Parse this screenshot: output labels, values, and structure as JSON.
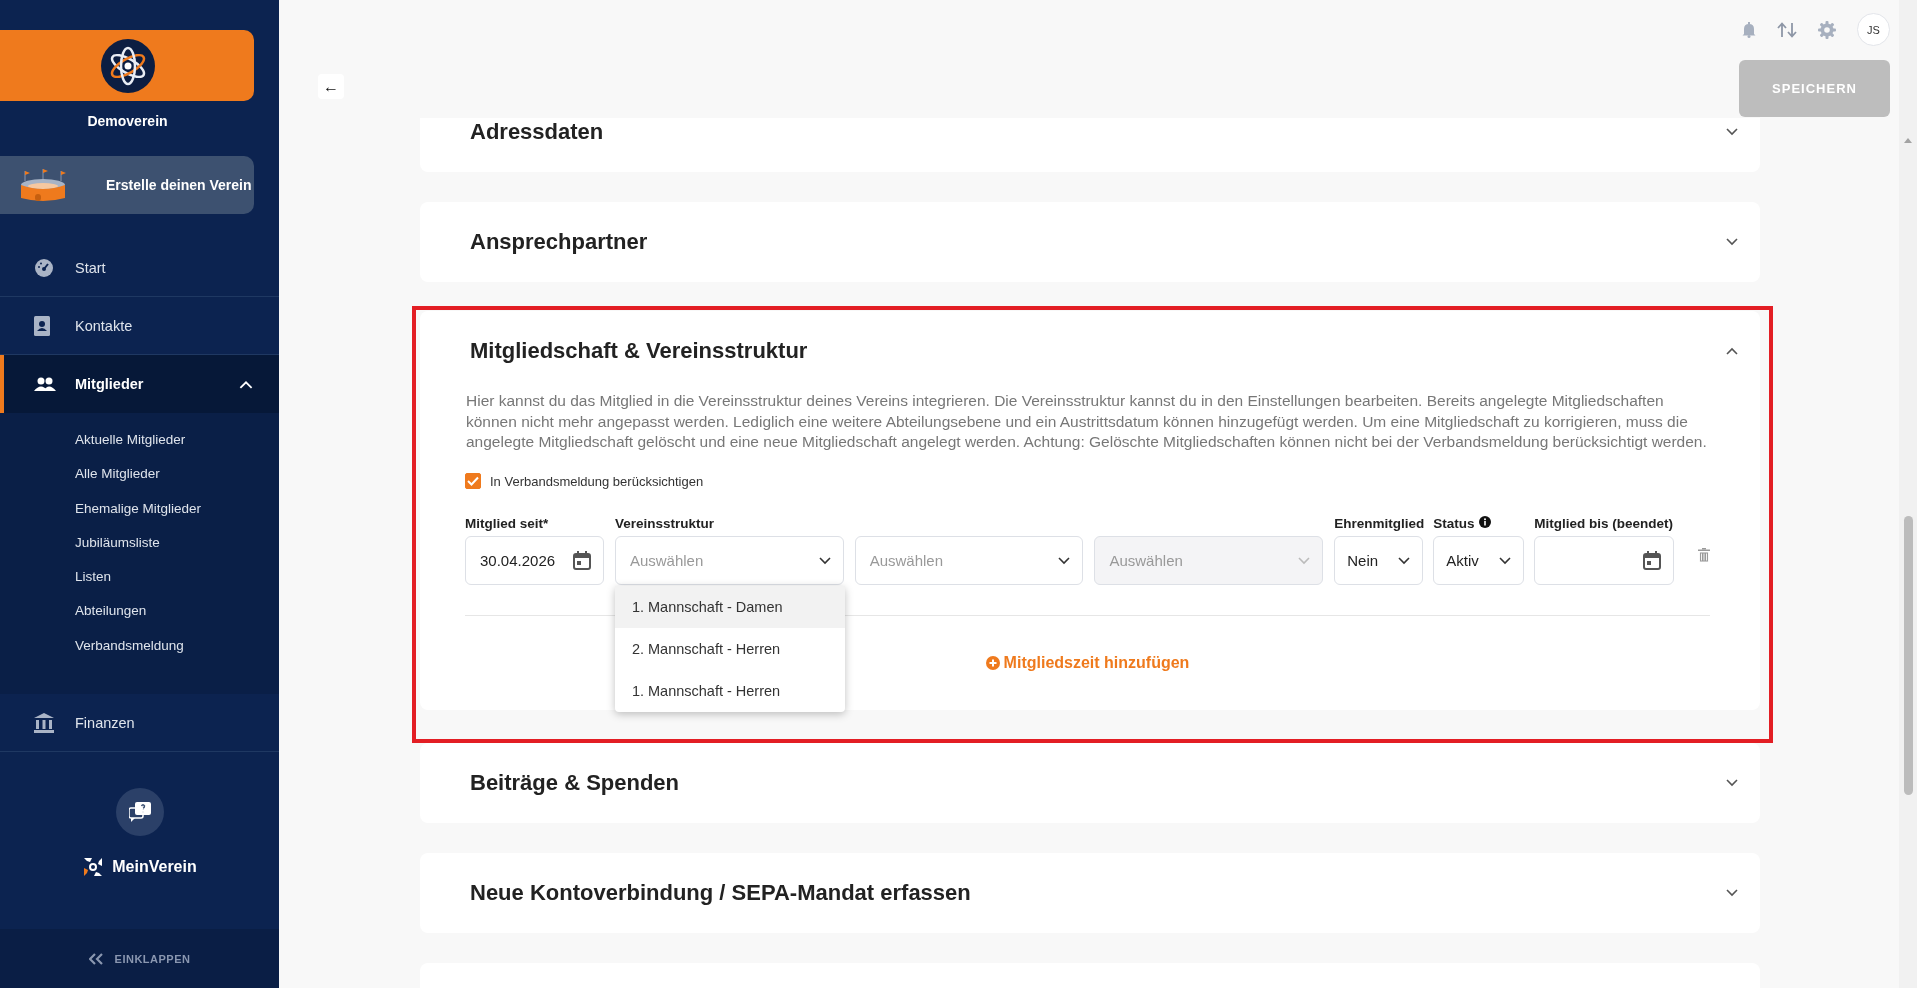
{
  "sidebar": {
    "club_name": "Demoverein",
    "create_club": "Erstelle deinen Verein",
    "nav": [
      {
        "label": "Start",
        "selected": false
      },
      {
        "label": "Kontakte",
        "selected": false
      },
      {
        "label": "Mitglieder",
        "selected": true,
        "expanded": true,
        "children": [
          {
            "label": "Aktuelle Mitglieder",
            "selected": false
          },
          {
            "label": "Alle Mitglieder",
            "selected": false
          },
          {
            "label": "Ehemalige Mitglieder",
            "selected": false
          },
          {
            "label": "Jubiläumsliste",
            "selected": false
          },
          {
            "label": "Listen",
            "selected": false
          },
          {
            "label": "Abteilungen",
            "selected": false
          },
          {
            "label": "Verbandsmeldung",
            "selected": false
          }
        ]
      },
      {
        "label": "Finanzen",
        "selected": false
      }
    ],
    "brand": "MeinVerein",
    "collapse": "EINKLAPPEN"
  },
  "topbar": {
    "back": "←",
    "avatar": "JS",
    "save": {
      "label": "SPEICHERN",
      "disabled": true
    }
  },
  "sections": [
    {
      "title": "Adressdaten",
      "expanded": false,
      "highlighted": false
    },
    {
      "title": "Ansprechpartner",
      "expanded": false,
      "highlighted": false
    },
    {
      "title": "Mitgliedschaft & Vereinsstruktur",
      "expanded": true,
      "highlighted": true,
      "description": "Hier kannst du das Mitglied in die Vereinsstruktur deines Vereins integrieren. Die Vereinsstruktur kannst du in den Einstellungen bearbeiten. Bereits angelegte Mitgliedschaften können nicht mehr angepasst werden. Lediglich eine weitere Abteilungsebene und ein Austrittsdatum können hinzugefügt werden. Um eine Mitgliedschaft zu korrigieren, muss die angelegte Mitgliedschaft gelöscht und eine neue Mitgliedschaft angelegt werden. Achtung: Gelöschte Mitgliedschaften können nicht bei der Verbandsmeldung berücksichtigt werden.",
      "checkbox": {
        "label": "In Verbandsmeldung berücksichtigen",
        "checked": true
      },
      "fields": [
        {
          "kind": "date",
          "label": "Mitglied seit*",
          "value": "30.04.2026"
        },
        {
          "kind": "select",
          "label": "Vereinsstruktur",
          "placeholder": "Auswählen",
          "disabled": false,
          "open": true,
          "options": [
            {
              "label": "1. Mannschaft - Damen",
              "highlighted": true
            },
            {
              "label": "2. Mannschaft - Herren",
              "highlighted": false
            },
            {
              "label": "1. Mannschaft - Herren",
              "highlighted": false
            }
          ]
        },
        {
          "kind": "select",
          "placeholder": "Auswählen",
          "disabled": false
        },
        {
          "kind": "select",
          "placeholder": "Auswählen",
          "disabled": true
        },
        {
          "kind": "select",
          "label": "Ehrenmitglied",
          "value": "Nein",
          "disabled": false
        },
        {
          "kind": "select",
          "label": "Status",
          "info": true,
          "value": "Aktiv",
          "disabled": false
        },
        {
          "kind": "date",
          "label": "Mitglied bis (beendet)"
        }
      ],
      "add_link": "Mitgliedszeit hinzufügen"
    },
    {
      "title": "Beiträge & Spenden",
      "expanded": false,
      "highlighted": false
    },
    {
      "title": "Neue Kontoverbindung / SEPA-Mandat erfassen",
      "expanded": false,
      "highlighted": false
    }
  ]
}
